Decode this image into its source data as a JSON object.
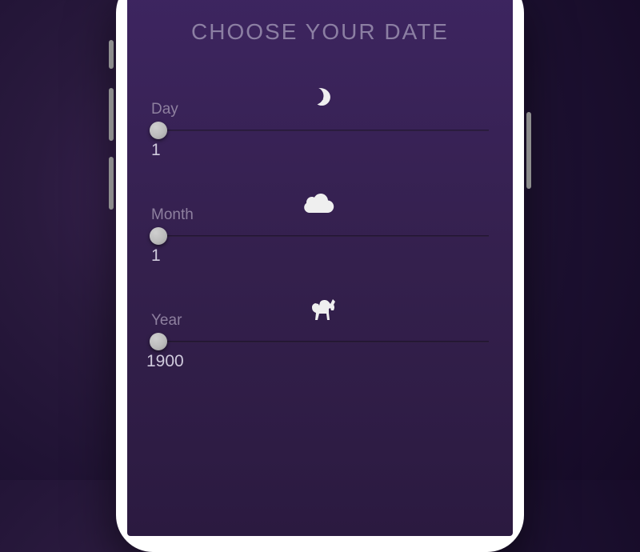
{
  "heading": "CHOOSE YOUR DATE",
  "sliders": {
    "day": {
      "label": "Day",
      "value": "1",
      "icon": "moon"
    },
    "month": {
      "label": "Month",
      "value": "1",
      "icon": "cloud"
    },
    "year": {
      "label": "Year",
      "value": "1900",
      "icon": "horse"
    }
  }
}
